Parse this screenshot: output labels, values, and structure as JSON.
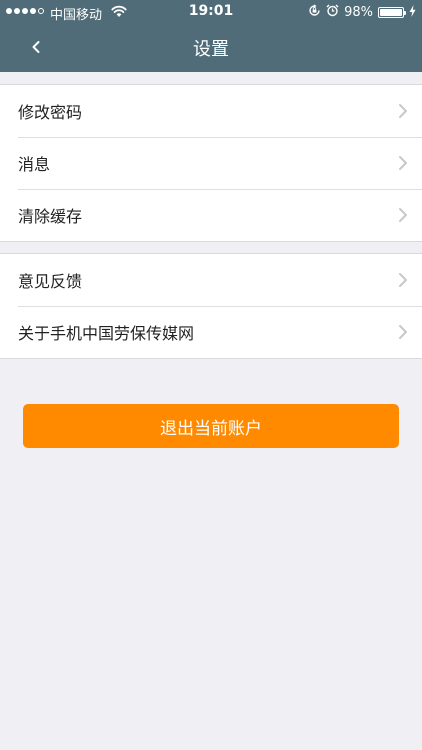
{
  "status_bar": {
    "carrier": "中国移动",
    "time": "19:01",
    "battery_text": "98%",
    "battery_level": 0.98,
    "signal_dots_filled": 4,
    "signal_dots_total": 5,
    "icons": [
      "wifi-icon",
      "rotation-lock-icon",
      "alarm-icon",
      "battery-icon",
      "charging-bolt-icon"
    ]
  },
  "nav": {
    "title": "设置",
    "back_icon": "chevron-left-icon"
  },
  "groups": [
    {
      "items": [
        {
          "label": "修改密码"
        },
        {
          "label": "消息"
        },
        {
          "label": "清除缓存"
        }
      ]
    },
    {
      "items": [
        {
          "label": "意见反馈"
        },
        {
          "label": "关于手机中国劳保传媒网"
        }
      ]
    }
  ],
  "logout": {
    "label": "退出当前账户"
  },
  "colors": {
    "header_bg": "#4f6c78",
    "page_bg": "#efeff4",
    "accent_button": "#ff8a00",
    "chevron": "#c7c7cc"
  }
}
